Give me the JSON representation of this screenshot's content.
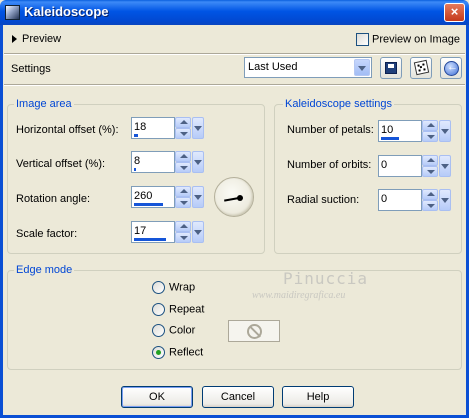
{
  "window": {
    "title": "Kaleidoscope",
    "close_glyph": "×"
  },
  "preview": {
    "label": "Preview",
    "preview_on_image_label": "Preview on Image",
    "preview_on_image_checked": false
  },
  "settings": {
    "label": "Settings",
    "preset_value": "Last Used"
  },
  "image_area": {
    "title": "Image area",
    "fields": [
      {
        "label": "Horizontal offset (%):",
        "value": "18",
        "level": 0.1
      },
      {
        "label": "Vertical offset (%):",
        "value": "8",
        "level": 0.05
      },
      {
        "label": "Rotation angle:",
        "value": "260",
        "level": 0.72
      },
      {
        "label": "Scale factor:",
        "value": "17",
        "level": 0.8
      }
    ]
  },
  "kaleidoscope": {
    "title": "Kaleidoscope settings",
    "fields": [
      {
        "label": "Number of petals:",
        "value": "10",
        "level": 0.45
      },
      {
        "label": "Number of orbits:",
        "value": "0",
        "level": 0
      },
      {
        "label": "Radial suction:",
        "value": "0",
        "level": 0
      }
    ]
  },
  "edge_mode": {
    "title": "Edge mode",
    "options": [
      "Wrap",
      "Repeat",
      "Color",
      "Reflect"
    ],
    "selected": "Reflect"
  },
  "watermark": {
    "line1": "Pinuccia",
    "line2": "www.maidiregrafica.eu"
  },
  "buttons": {
    "ok": "OK",
    "cancel": "Cancel",
    "help": "Help"
  }
}
